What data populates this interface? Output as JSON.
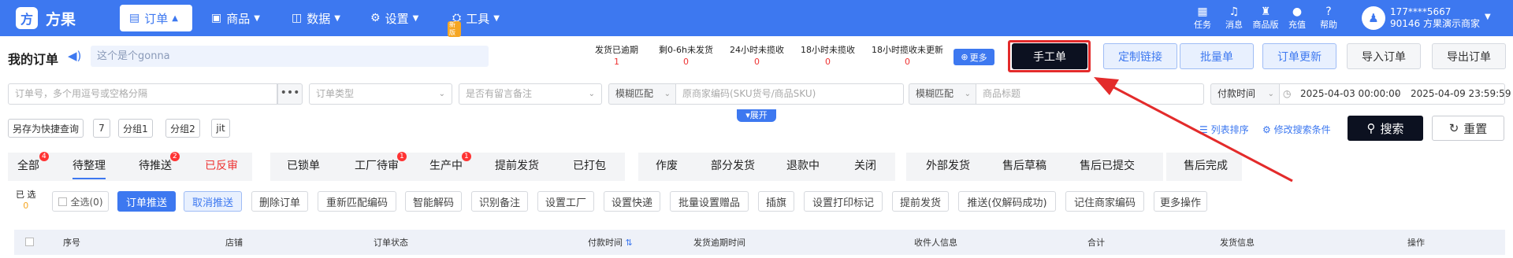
{
  "app": {
    "logo_char": "方",
    "name": "方果"
  },
  "nav": [
    {
      "label": "订单",
      "icon": "cart-icon",
      "active": true
    },
    {
      "label": "商品",
      "icon": "product-icon",
      "active": false
    },
    {
      "label": "数据",
      "icon": "chart-icon",
      "active": false
    },
    {
      "label": "设置",
      "icon": "gear-icon",
      "active": false
    },
    {
      "label": "工具",
      "icon": "tool-icon",
      "active": false,
      "badge": "新版"
    }
  ],
  "top_icons": [
    "任务",
    "消息",
    "商品版",
    "充值",
    "帮助"
  ],
  "user": {
    "phone": "177****5667",
    "account": "90146 方果演示商家"
  },
  "page": {
    "title": "我的订单",
    "notice": "这个是个gonna"
  },
  "stats": [
    {
      "label": "发货已逾期",
      "value": "1"
    },
    {
      "label": "剩0-6h未发货",
      "value": "0"
    },
    {
      "label": "24小时未揽收",
      "value": "0"
    },
    {
      "label": "18小时未揽收",
      "value": "0"
    },
    {
      "label": "18小时揽收未更新",
      "value": "0"
    }
  ],
  "more_label": "更多",
  "actions": [
    "手工单",
    "定制链接",
    "批量单",
    "订单更新",
    "导入订单",
    "导出订单"
  ],
  "filters": {
    "order_no": "订单号，多个用逗号或空格分隔",
    "order_type": "订单类型",
    "remark": "是否有留言备注",
    "match1": "模糊匹配",
    "sku": "原商家编码(SKU货号/商品SKU)",
    "match2": "模糊匹配",
    "goods_title": "商品标题",
    "pay_time": "付款时间",
    "date_from": "2025-04-03 00:00:00",
    "date_sep": "-",
    "date_to": "2025-04-09 23:59:59",
    "expand": "展开"
  },
  "quick": [
    "另存为快捷查询",
    "7",
    "分组1",
    "分组2",
    "jit"
  ],
  "sort_link": "列表排序",
  "modify_link": "修改搜索条件",
  "search_label": "搜索",
  "reset_label": "重置",
  "tabs": [
    {
      "label": "全部",
      "badge": "4"
    },
    {
      "label": "待整理",
      "active": true
    },
    {
      "label": "待推送",
      "badge": "2"
    },
    {
      "label": "已反审",
      "red": true
    },
    {
      "label": "已锁单"
    },
    {
      "label": "工厂待审",
      "badge": "1"
    },
    {
      "label": "生产中",
      "badge": "1"
    },
    {
      "label": "提前发货"
    },
    {
      "label": "已打包"
    },
    {
      "label": "作废"
    },
    {
      "label": "部分发货"
    },
    {
      "label": "退款中"
    },
    {
      "label": "关闭"
    },
    {
      "label": "外部发货"
    },
    {
      "label": "售后草稿"
    },
    {
      "label": "售后已提交"
    },
    {
      "label": "售后完成"
    }
  ],
  "selected": {
    "label": "已 选",
    "count": "0"
  },
  "check_all": "全选(0)",
  "ops": [
    "订单推送",
    "取消推送",
    "删除订单",
    "重新匹配编码",
    "智能解码",
    "识别备注",
    "设置工厂",
    "设置快递",
    "批量设置赠品",
    "插旗",
    "设置打印标记",
    "提前发货",
    "推送(仅解码成功)",
    "记住商家编码",
    "更多操作"
  ],
  "columns": [
    "序号",
    "店铺",
    "订单状态",
    "付款时间",
    "发货逾期时间",
    "收件人信息",
    "合计",
    "发货信息",
    "操作"
  ],
  "colors": {
    "brand": "#3d78f0",
    "annotation": "#e32b2b"
  }
}
